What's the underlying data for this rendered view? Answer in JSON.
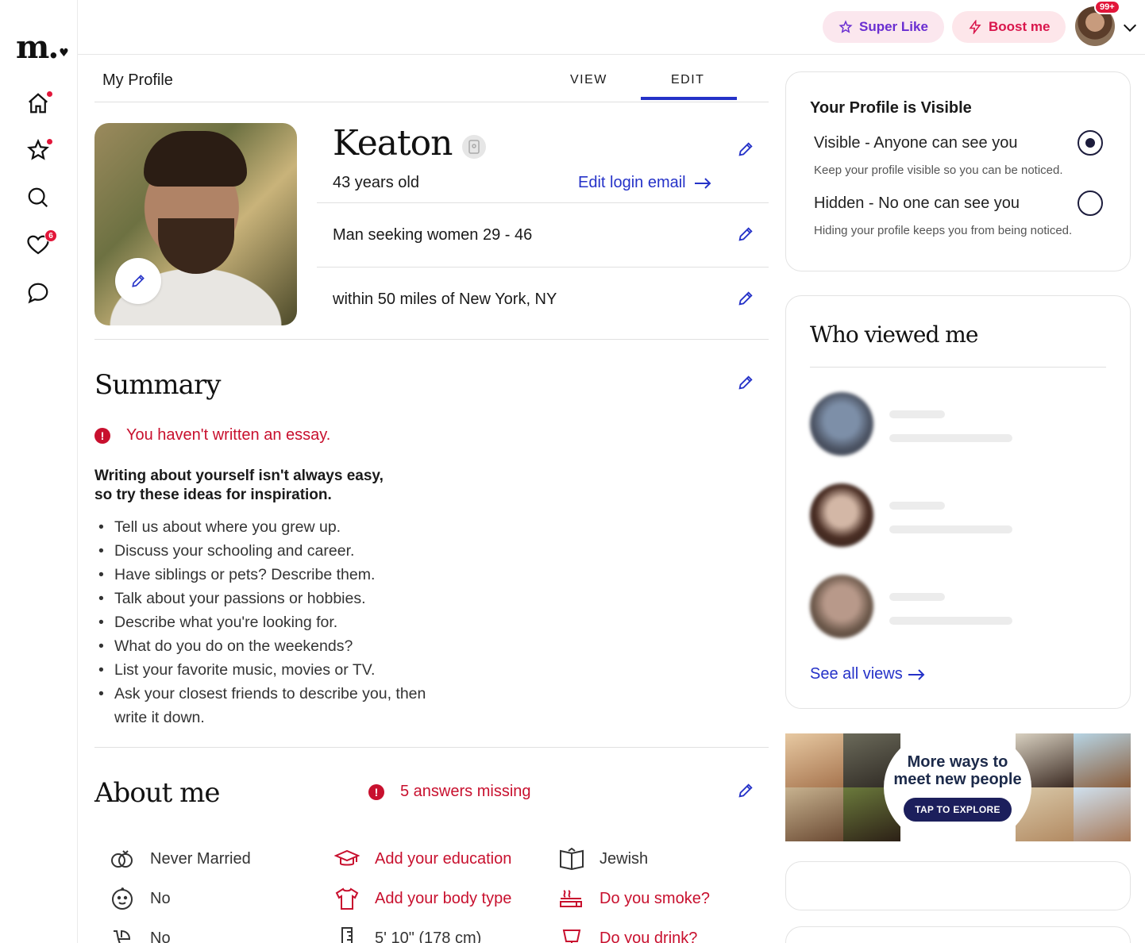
{
  "logo": {
    "text": "m.",
    "heart": "♥"
  },
  "nav": {
    "home": {
      "icon": "home-icon",
      "has_dot": true
    },
    "favorites": {
      "icon": "star-icon",
      "has_dot": true
    },
    "search": {
      "icon": "search-icon"
    },
    "likes": {
      "icon": "heart-icon",
      "badge": "6"
    },
    "messages": {
      "icon": "chat-icon"
    }
  },
  "topbar": {
    "super_like": "Super Like",
    "boost": "Boost me",
    "notif_badge": "99+"
  },
  "tabs": {
    "title": "My Profile",
    "view": "VIEW",
    "edit": "EDIT",
    "active": "EDIT"
  },
  "profile": {
    "name": "Keaton",
    "age": "43 years old",
    "edit_login": "Edit login email",
    "seeking": "Man seeking women 29 - 46",
    "location": "within 50 miles of New York, NY"
  },
  "summary": {
    "title": "Summary",
    "alert": "You haven't written an essay.",
    "tips_heading_1": "Writing about yourself isn't always easy,",
    "tips_heading_2": "so try these ideas for inspiration.",
    "tips": [
      "Tell us about where you grew up.",
      "Discuss your schooling and career.",
      "Have siblings or pets? Describe them.",
      "Talk about your passions or hobbies.",
      "Describe what you're looking for.",
      "What do you do on the weekends?",
      "List your favorite music, movies or TV.",
      "Ask your closest friends to describe you, then write it down."
    ]
  },
  "about": {
    "title": "About me",
    "alert": "5 answers missing",
    "items": [
      {
        "icon": "rings-icon",
        "text": "Never Married",
        "missing": false
      },
      {
        "icon": "graduation-cap-icon",
        "text": "Add your education",
        "missing": true
      },
      {
        "icon": "book-icon",
        "text": "Jewish",
        "missing": false
      },
      {
        "icon": "baby-face-icon",
        "text": "No",
        "missing": false
      },
      {
        "icon": "shirt-icon",
        "text": "Add your body type",
        "missing": true
      },
      {
        "icon": "cigarette-icon",
        "text": "Do you smoke?",
        "missing": true
      },
      {
        "icon": "stroller-icon",
        "text": "No",
        "missing": false
      },
      {
        "icon": "ruler-icon",
        "text": "5' 10\" (178 cm)",
        "missing": false
      },
      {
        "icon": "glass-icon",
        "text": "Do you drink?",
        "missing": true
      }
    ]
  },
  "visibility": {
    "title": "Your Profile is Visible",
    "visible_label": "Visible - Anyone can see you",
    "visible_sub": "Keep your profile visible so you can be noticed.",
    "hidden_label": "Hidden - No one can see you",
    "hidden_sub": "Hiding your profile keeps you from being noticed.",
    "selected": "visible"
  },
  "who_viewed": {
    "title": "Who viewed me",
    "see_all": "See all views"
  },
  "promo": {
    "line1": "More ways to",
    "line2": "meet new people",
    "button": "TAP TO EXPLORE"
  },
  "colors": {
    "accent": "#2532c8",
    "alert": "#c8102e",
    "badge": "#e2163a",
    "super_like": "#6a2ed1",
    "boost": "#d9164c"
  }
}
